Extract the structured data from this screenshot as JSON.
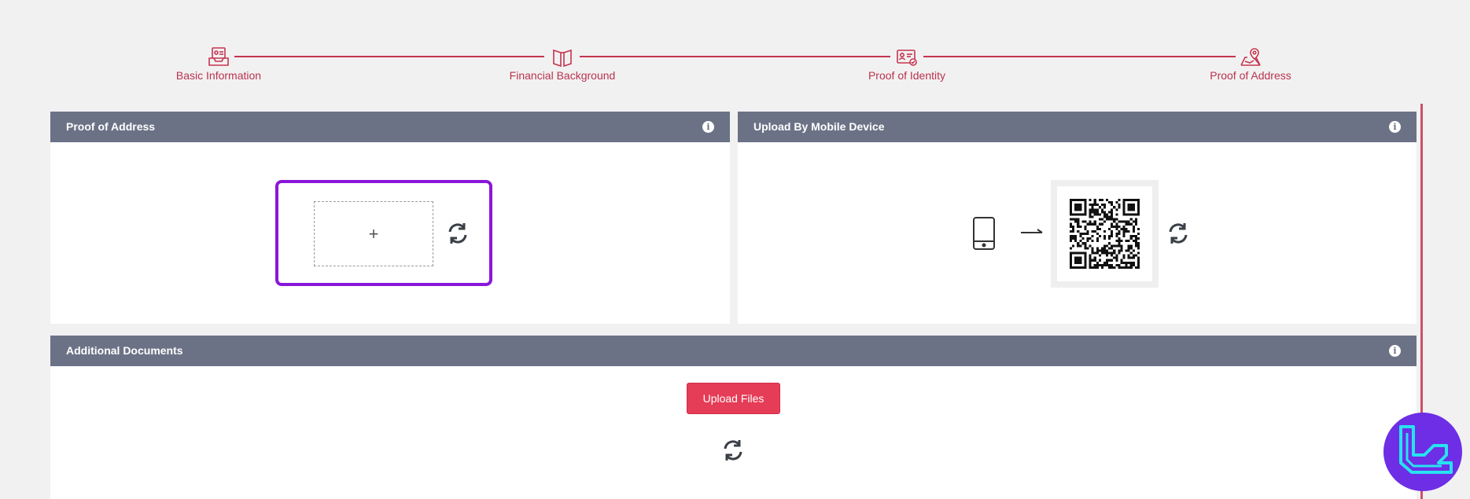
{
  "stepper": {
    "steps": [
      {
        "label": "Basic Information",
        "icon": "id-tray-icon"
      },
      {
        "label": "Financial Background",
        "icon": "open-book-icon"
      },
      {
        "label": "Proof of Identity",
        "icon": "id-card-check-icon"
      },
      {
        "label": "Proof of Address",
        "icon": "map-pin-icon"
      }
    ],
    "color": "#c4354f"
  },
  "panels": {
    "proof_of_address": {
      "title": "Proof of Address",
      "info_icon": "info-icon",
      "dropzone_symbol": "+"
    },
    "upload_by_mobile": {
      "title": "Upload By Mobile Device",
      "info_icon": "info-icon"
    },
    "additional_documents": {
      "title": "Additional Documents",
      "info_icon": "info-icon",
      "upload_button_label": "Upload Files"
    }
  },
  "colors": {
    "header_bg": "#6c7286",
    "accent": "#e53c57",
    "highlight": "#8a17d8",
    "brand": "#6d2ee6"
  }
}
